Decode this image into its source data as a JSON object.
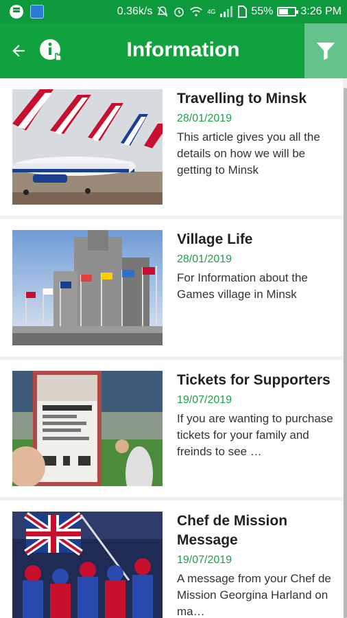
{
  "status_bar": {
    "network_speed": "0.36k/s",
    "network_type": "4G",
    "battery_percent": "55%",
    "battery_level": 0.55,
    "time": "3:26 PM"
  },
  "app_bar": {
    "title": "Information",
    "accent_color": "#10a23f",
    "filter_button_color": "#63c38a",
    "back_icon": "arrow-left-icon",
    "info_icon": "info-touch-icon",
    "filter_icon": "filter-funnel-icon"
  },
  "articles": [
    {
      "title": "Travelling to Minsk",
      "date": "28/01/2019",
      "description": "This article gives you all the details on how we will be getting to Minsk",
      "image": "british-airways-planes-image"
    },
    {
      "title": "Village Life",
      "date": "28/01/2019",
      "description": "For Information about the Games village in Minsk",
      "image": "building-with-flags-image"
    },
    {
      "title": "Tickets for Supporters",
      "date": "19/07/2019",
      "description": "If you are wanting to purchase tickets for your family and freinds to see …",
      "image": "fenway-park-ticket-image"
    },
    {
      "title": "Chef de Mission Message",
      "date": "19/07/2019",
      "description": "A message from your Chef de Mission Georgina Harland on ma…",
      "image": "team-gb-flag-parade-image"
    }
  ]
}
